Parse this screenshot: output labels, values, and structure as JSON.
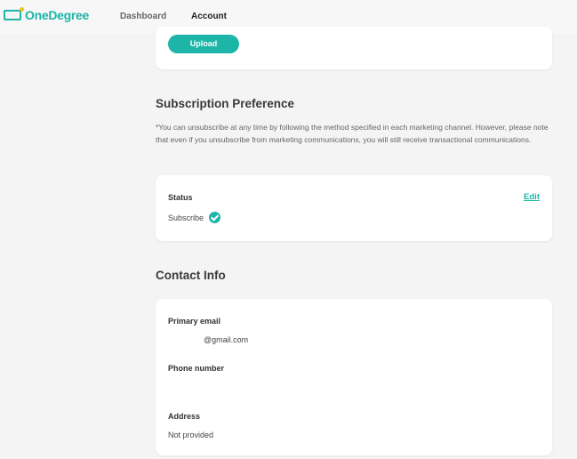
{
  "header": {
    "logo_text": "OneDegree",
    "nav": [
      {
        "label": "Dashboard"
      },
      {
        "label": "Account"
      }
    ],
    "active_tab": "Account"
  },
  "upload_section": {
    "button_label": "Upload"
  },
  "subscription": {
    "title": "Subscription Preference",
    "note": "*You can unsubscribe at any time by following the method specified in each marketing channel. However, please note that even if you unsubscribe from marketing communications, you will still receive transactional communications.",
    "status_label": "Status",
    "status_value": "Subscribe",
    "edit_label": "Edit"
  },
  "contact": {
    "title": "Contact Info",
    "email_label": "Primary email",
    "email_value": "@gmail.com",
    "phone_label": "Phone number",
    "phone_value": "",
    "address_label": "Address",
    "address_value": "Not provided"
  },
  "colors": {
    "accent": "#1cb5a7",
    "highlight": "#f5c21b",
    "background": "#f4f4f4"
  }
}
